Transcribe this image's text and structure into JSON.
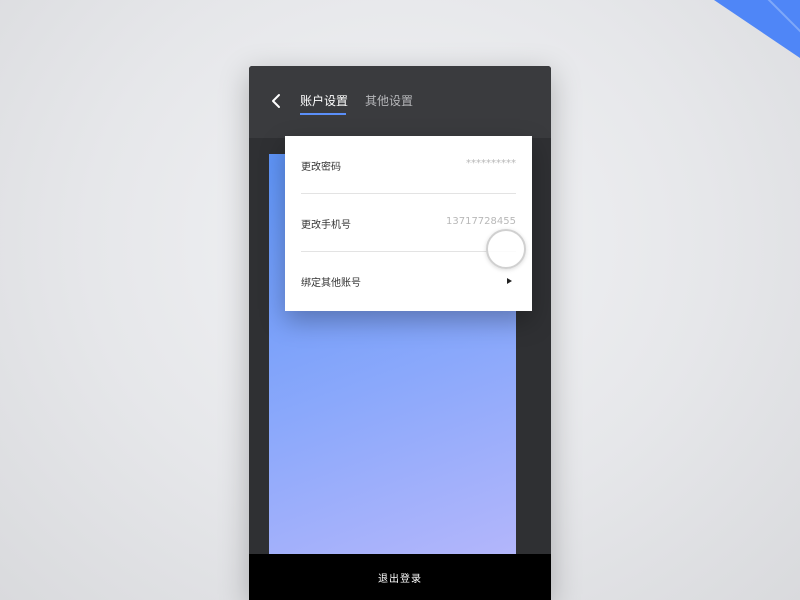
{
  "header": {
    "tabs": [
      {
        "label": "账户设置",
        "active": true
      },
      {
        "label": "其他设置",
        "active": false
      }
    ]
  },
  "menu": {
    "items": [
      {
        "label": "更改密码",
        "value": "**********"
      },
      {
        "label": "更改手机号",
        "value": "13717728455"
      },
      {
        "label": "绑定其他账号",
        "value": ""
      }
    ]
  },
  "footer": {
    "logout_label": "退出登录"
  },
  "colors": {
    "accent": "#5b8ff9",
    "card_gradient_start": "#5e94f7",
    "card_gradient_end": "#b3b6fb",
    "phone_bg": "#2f3033"
  },
  "icons": {
    "back": "chevron-left-icon",
    "row_arrow": "triangle-right-icon"
  }
}
